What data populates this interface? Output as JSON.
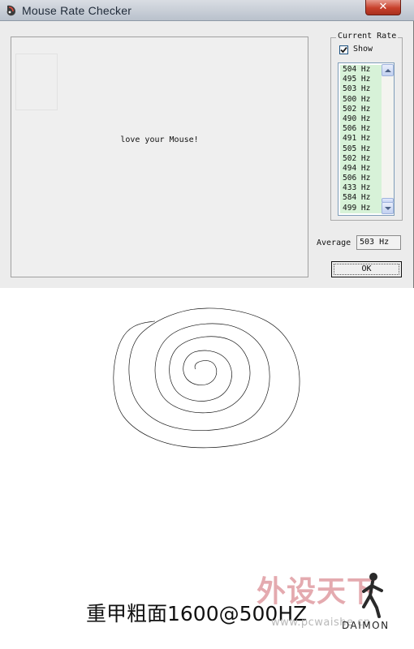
{
  "window": {
    "title": "Mouse Rate Checker",
    "close_glyph": "✕"
  },
  "canvas": {
    "message": "love your Mouse!"
  },
  "rate_group": {
    "label": "Current Rate",
    "show_checked": true,
    "show_label": "Show",
    "items": [
      "504 Hz",
      "495 Hz",
      "503 Hz",
      "500 Hz",
      "502 Hz",
      "490 Hz",
      "506 Hz",
      "491 Hz",
      "505 Hz",
      "502 Hz",
      "494 Hz",
      "506 Hz",
      "433 Hz",
      "584 Hz",
      "499 Hz"
    ]
  },
  "average": {
    "label": "Average",
    "value": "503 Hz"
  },
  "ok_button": {
    "label": "OK"
  },
  "drawing": {
    "stroke_color": "#111111",
    "caption": "重甲粗面1600@500HZ",
    "watermark": "外设天下",
    "watermark_url": "www.pcwaishe.cn",
    "signature": "DAIMON"
  },
  "colors": {
    "list_highlight": "#d7f2d8",
    "title_close": "#c7402b"
  },
  "icons": {
    "app": "mouse-app-icon",
    "close": "close-icon",
    "check": "checkmark-icon",
    "scroll_up": "scroll-up-arrow-icon",
    "scroll_down": "scroll-down-arrow-icon"
  }
}
